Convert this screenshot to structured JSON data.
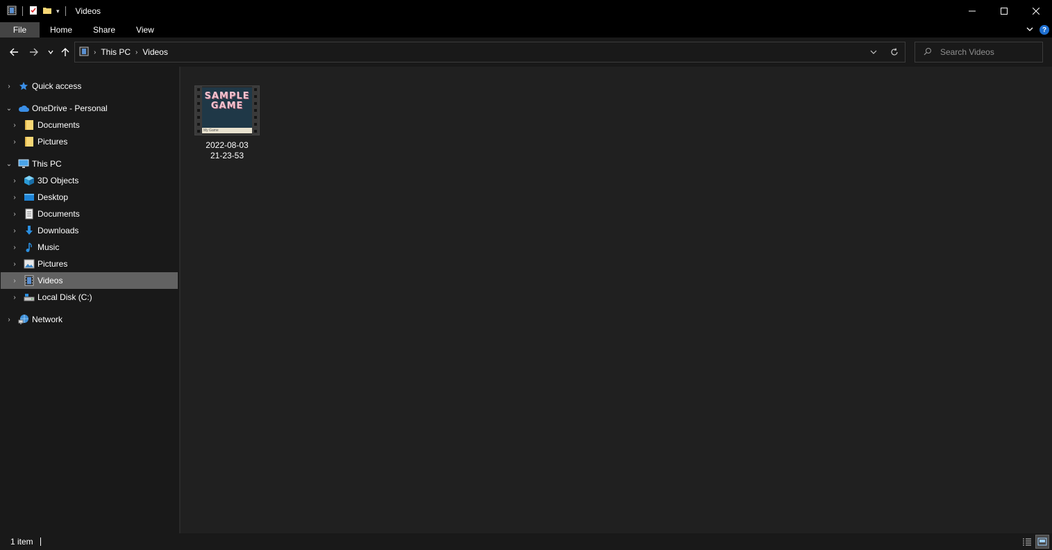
{
  "window": {
    "title": "Videos"
  },
  "window_controls": {
    "minimize": "—",
    "maximize": "☐",
    "close": "✕"
  },
  "ribbon": {
    "tabs": [
      {
        "label": "File"
      },
      {
        "label": "Home"
      },
      {
        "label": "Share"
      },
      {
        "label": "View"
      }
    ]
  },
  "address": {
    "crumbs": [
      "This PC",
      "Videos"
    ]
  },
  "search": {
    "placeholder": "Search Videos"
  },
  "nav": {
    "items": [
      {
        "label": "Quick access",
        "icon": "star-icon"
      },
      {
        "label": "OneDrive - Personal",
        "icon": "cloud-icon"
      },
      {
        "label": "Documents",
        "icon": "folder-icon"
      },
      {
        "label": "Pictures",
        "icon": "folder-icon"
      },
      {
        "label": "This PC",
        "icon": "computer-icon"
      },
      {
        "label": "3D Objects",
        "icon": "cube-icon"
      },
      {
        "label": "Desktop",
        "icon": "desktop-icon"
      },
      {
        "label": "Documents",
        "icon": "document-icon"
      },
      {
        "label": "Downloads",
        "icon": "download-icon"
      },
      {
        "label": "Music",
        "icon": "music-icon"
      },
      {
        "label": "Pictures",
        "icon": "pictures-icon"
      },
      {
        "label": "Videos",
        "icon": "video-icon",
        "selected": true
      },
      {
        "label": "Local Disk (C:)",
        "icon": "disk-icon"
      },
      {
        "label": "Network",
        "icon": "network-icon"
      }
    ]
  },
  "files": [
    {
      "name_line1": "2022-08-03",
      "name_line2": "21-23-53",
      "thumbnail": {
        "logo_line1": "SAMPLE",
        "logo_line2": "GAME",
        "footer": "My Game"
      }
    }
  ],
  "status": {
    "item_count": "1 item"
  },
  "colors": {
    "background": "#191919",
    "content": "#202020",
    "selected": "#626262",
    "accent_blue": "#1e6fd0",
    "folder_yellow": "#f8d775"
  }
}
